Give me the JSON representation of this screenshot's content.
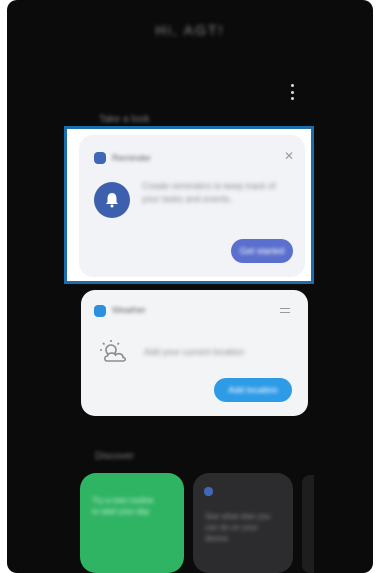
{
  "greeting": "Hi, AGT!",
  "section_upcoming": "Take a look",
  "reminder_card": {
    "app_name": "Reminder",
    "body": "Create reminders to keep track of your tasks and events.",
    "button": "Get started"
  },
  "weather_card": {
    "app_name": "Weather",
    "body": "Add your current location",
    "button": "Add location"
  },
  "section_discover": "Discover",
  "tiles": [
    {
      "text": "Try a new routine to start your day"
    },
    {
      "text": "See what else you can do on your device"
    }
  ],
  "colors": {
    "accent_blue": "#3c5fae",
    "reminder_button": "#5a6fce",
    "weather_button": "#2d9be6",
    "highlight_frame": "#1d6cab",
    "green_tile": "#2fb463"
  }
}
